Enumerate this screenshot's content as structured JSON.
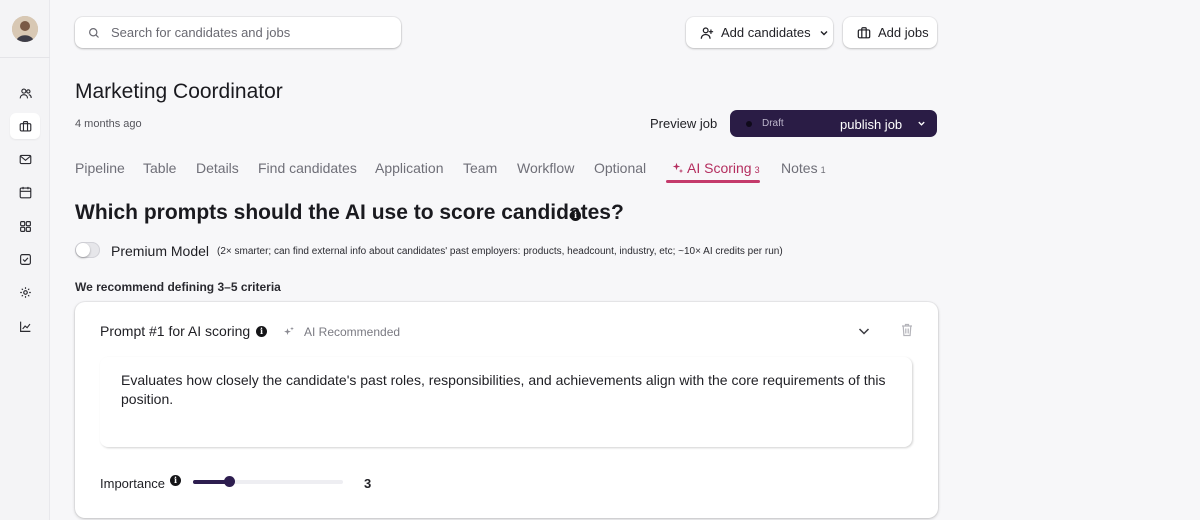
{
  "search": {
    "placeholder": "Search for candidates and jobs"
  },
  "header": {
    "add_candidates_label": "Add candidates",
    "add_jobs_label": "Add jobs"
  },
  "job": {
    "title": "Marketing Coordinator",
    "age": "4 months ago",
    "preview_label": "Preview job",
    "status_label": "Draft",
    "publish_label": "publish job"
  },
  "tabs": [
    {
      "label": "Pipeline",
      "count": ""
    },
    {
      "label": "Table",
      "count": ""
    },
    {
      "label": "Details",
      "count": ""
    },
    {
      "label": "Find candidates",
      "count": ""
    },
    {
      "label": "Application",
      "count": ""
    },
    {
      "label": "Team",
      "count": ""
    },
    {
      "label": "Workflow",
      "count": ""
    },
    {
      "label": "Optional",
      "count": ""
    },
    {
      "label": "AI Scoring",
      "count": "3",
      "active": true
    },
    {
      "label": "Notes",
      "count": "1"
    }
  ],
  "scoring": {
    "heading": "Which prompts should the AI use to score candidates?",
    "premium_label": "Premium Model",
    "premium_enabled": false,
    "premium_note": "(2× smarter; can find external info about candidates' past employers: products, headcount, industry, etc; ~10× AI credits per run)",
    "recommendation": "We recommend defining 3–5 criteria",
    "prompts": [
      {
        "title": "Prompt #1 for AI scoring",
        "badge": "AI Recommended",
        "text": "Evaluates how closely the candidate's past roles, responsibilities, and achievements align with the core requirements of this position.",
        "importance_label": "Importance",
        "importance_value": "3",
        "importance_fraction": 0.24
      }
    ]
  },
  "colors": {
    "accent": "#c43a6b",
    "primary_dark": "#2a1c45",
    "slider": "#2d1d4f"
  },
  "sidebar": {
    "icons": [
      "users-icon",
      "briefcase-icon",
      "mail-icon",
      "calendar-icon",
      "apps-icon",
      "task-check-icon",
      "settings-icon",
      "chart-icon"
    ],
    "active_icon": "briefcase-icon"
  }
}
